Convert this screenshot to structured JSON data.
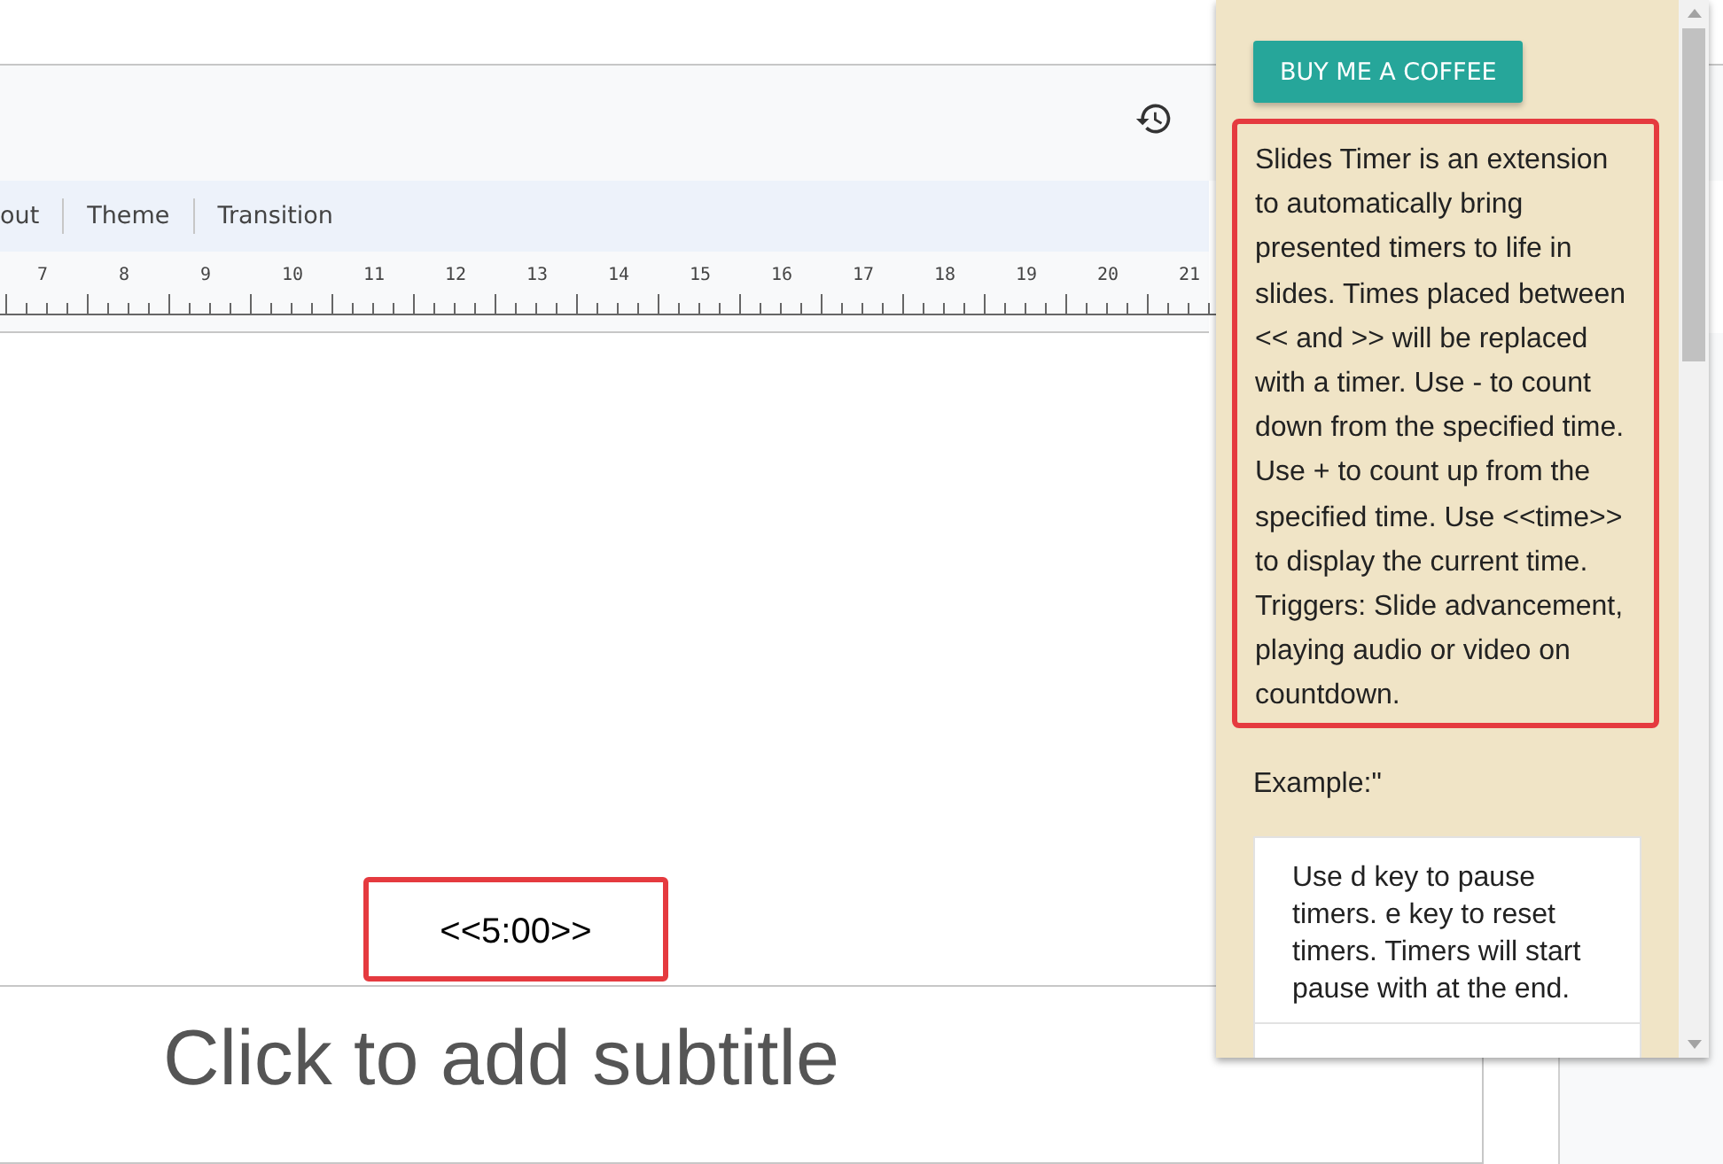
{
  "menu": {
    "items": [
      {
        "label": "out"
      },
      {
        "label": "Theme"
      },
      {
        "label": "Transition"
      }
    ]
  },
  "ruler": {
    "numbers": [
      "7",
      "8",
      "9",
      "10",
      "11",
      "12",
      "13",
      "14",
      "15",
      "16",
      "17",
      "18",
      "19",
      "20",
      "21"
    ]
  },
  "slide": {
    "timer": "<<5:00>>",
    "subtitle_placeholder": "Click to add subtitle"
  },
  "panel": {
    "button": "BUY ME A COFFEE",
    "description": "Slides Timer is an extension to automatically bring presented timers to life in slides. Times placed between << and >> will be replaced with a timer. Use - to count down from the specified time. Use + to count up from the specified time. Use <<time>> to display the current time.",
    "triggers": "Triggers: Slide advancement, playing audio or video on countdown.",
    "example_label": "Example:\"",
    "examples": [
      "Use d key to pause timers. e key to reset timers. Timers will start pause with at the end."
    ]
  }
}
